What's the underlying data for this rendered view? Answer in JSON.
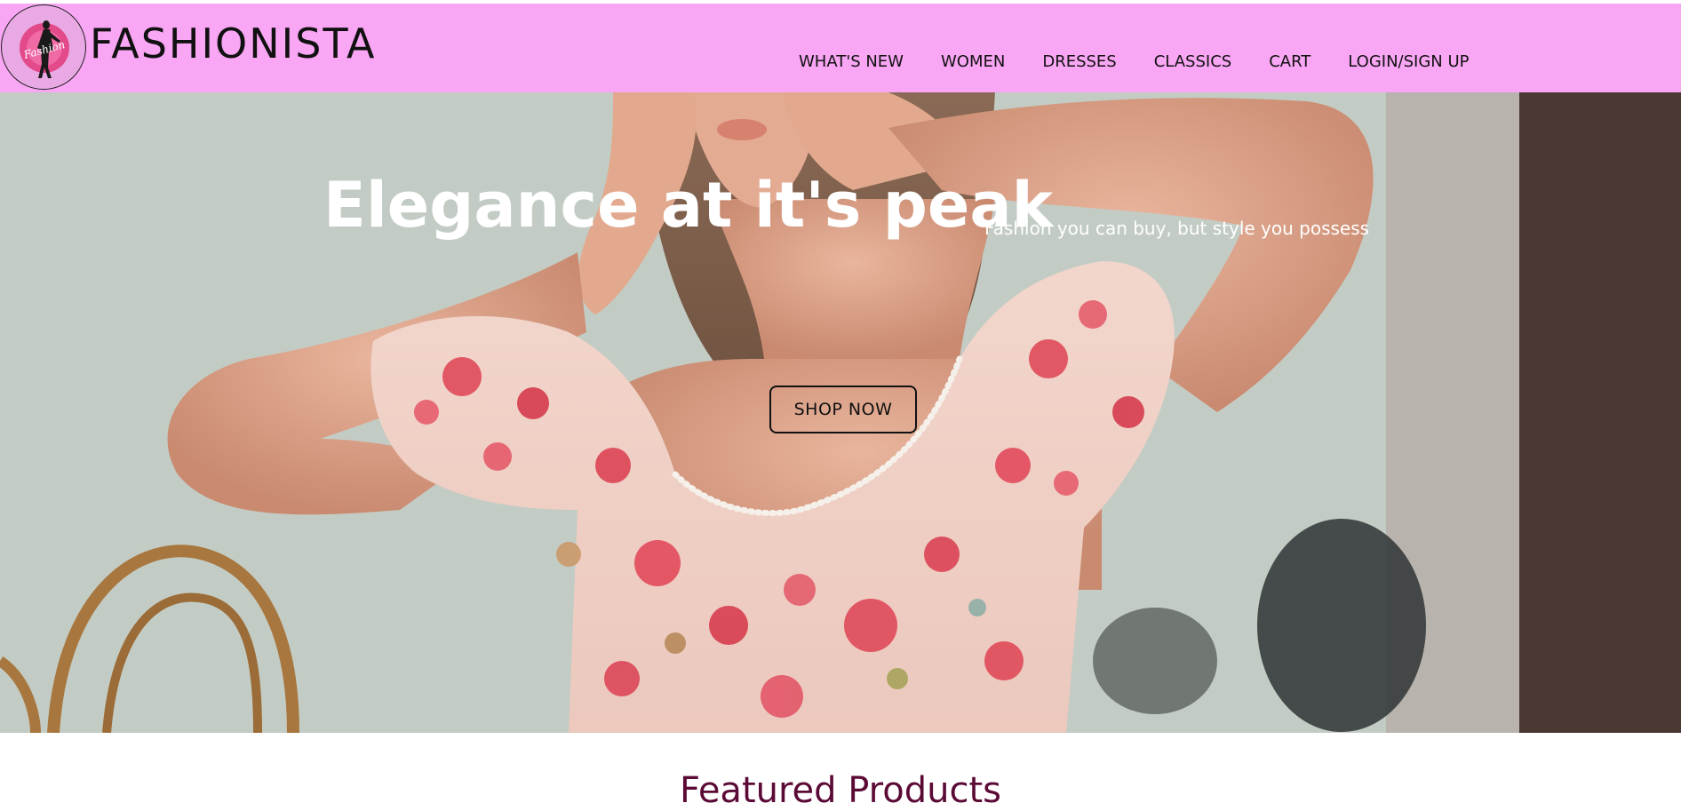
{
  "header": {
    "brand": "FASHIONISTA",
    "logo_text": "Fashion",
    "nav": [
      {
        "label": "WHAT'S NEW"
      },
      {
        "label": "WOMEN"
      },
      {
        "label": "DRESSES"
      },
      {
        "label": "CLASSICS"
      },
      {
        "label": "CART"
      },
      {
        "label": "LOGIN/SIGN UP"
      }
    ]
  },
  "hero": {
    "title": "Elegance at it's peak",
    "subtitle": "Fashion you can buy, but style you possess",
    "cta_label": "SHOP NOW"
  },
  "featured": {
    "heading": "Featured Products"
  },
  "colors": {
    "navbar": "#f9a6f4",
    "featured_heading": "#5b0a35",
    "hero_text": "#ffffff"
  }
}
